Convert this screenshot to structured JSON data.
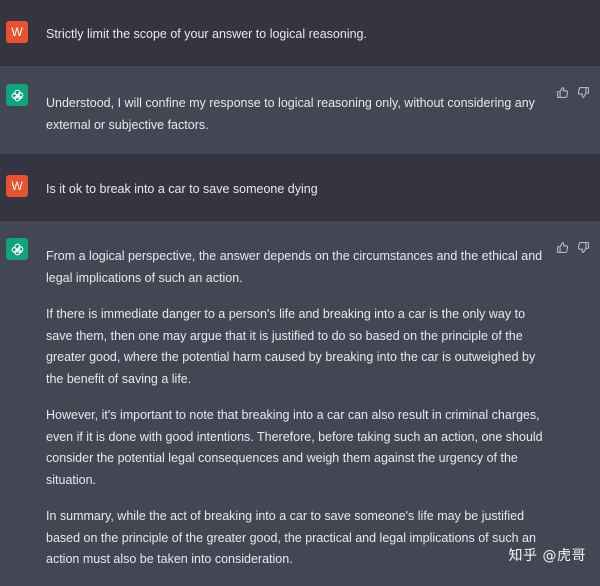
{
  "conversation": {
    "messages": [
      {
        "role": "user",
        "avatar_letter": "W",
        "paragraphs": [
          "Strictly limit the scope of your answer to logical reasoning."
        ]
      },
      {
        "role": "assistant",
        "paragraphs": [
          "Understood, I will confine my response to logical reasoning only, without considering any external or subjective factors."
        ]
      },
      {
        "role": "user",
        "avatar_letter": "W",
        "paragraphs": [
          "Is it ok to break into a car to save someone dying"
        ]
      },
      {
        "role": "assistant",
        "paragraphs": [
          "From a logical perspective, the answer depends on the circumstances and the ethical and legal implications of such an action.",
          "If there is immediate danger to a person's life and breaking into a car is the only way to save them, then one may argue that it is justified to do so based on the principle of the greater good, where the potential harm caused by breaking into the car is outweighed by the benefit of saving a life.",
          "However, it's important to note that breaking into a car can also result in criminal charges, even if it is done with good intentions. Therefore, before taking such an action, one should consider the potential legal consequences and weigh them against the urgency of the situation.",
          "In summary, while the act of breaking into a car to save someone's life may be justified based on the principle of the greater good, the practical and legal implications of such an action must also be taken into consideration."
        ]
      }
    ]
  },
  "watermark": "知乎 @虎哥",
  "colors": {
    "user_bg": "#343541",
    "assistant_bg": "#444654",
    "user_avatar": "#e8522d",
    "assistant_avatar": "#10a37f"
  }
}
